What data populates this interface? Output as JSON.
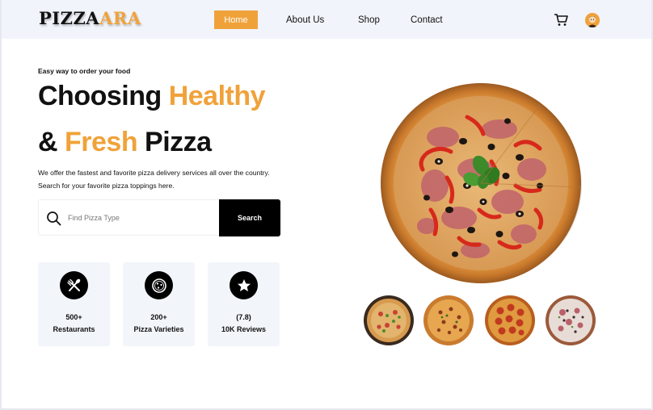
{
  "brand": {
    "part1": "PIZZA",
    "part2": "ARA"
  },
  "nav": {
    "home": "Home",
    "about": "About Us",
    "shop": "Shop",
    "contact": "Contact"
  },
  "hero": {
    "tagline": "Easy way to order your food",
    "line1_a": "Choosing ",
    "line1_b": "Healthy",
    "line2_a": "& ",
    "line2_b": "Fresh",
    "line2_c": " Pizza",
    "description_1": "We offer the fastest and favorite pizza delivery services all over the country.",
    "description_2": "Search for your favorite pizza toppings here."
  },
  "search": {
    "placeholder": "Find Pizza Type",
    "button": "Search"
  },
  "stats": [
    {
      "value": "500+",
      "label": "Restaurants",
      "icon": "utensils-icon"
    },
    {
      "value": "200+",
      "label": "Pizza Varieties",
      "icon": "pizza-icon"
    },
    {
      "value": "(7.8)",
      "label": "10K Reviews",
      "icon": "star-icon"
    }
  ],
  "colors": {
    "accent": "#f0a23a",
    "header_bg": "#f1f4fa",
    "card_bg": "#f2f5fa",
    "dark": "#000000"
  }
}
